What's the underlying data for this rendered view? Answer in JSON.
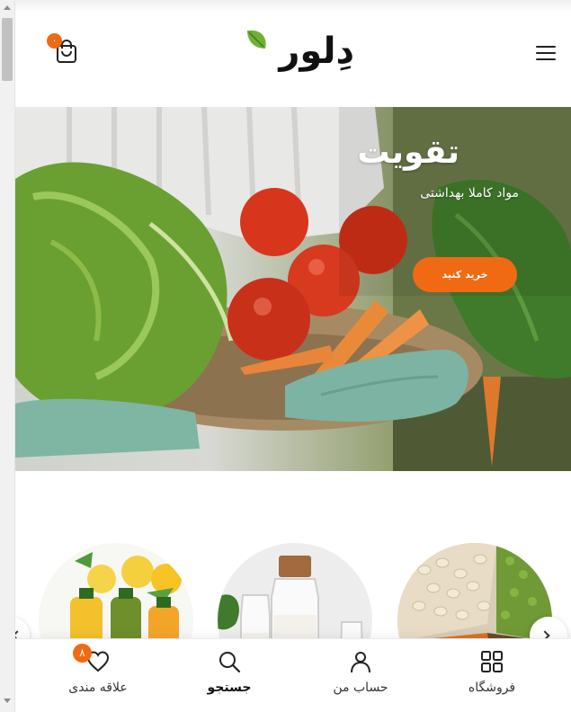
{
  "header": {
    "logo_text": "دِلور",
    "cart_count": "۰",
    "menu_icon": "hamburger-icon",
    "cart_icon": "shopping-bag-icon"
  },
  "hero": {
    "title": "تقویت",
    "subtitle": "مواد کاملا بهداشتی",
    "button_label": "خرید کنید"
  },
  "categories": {
    "items": [
      "juices",
      "milk",
      "grains-and-legumes"
    ],
    "prev_icon": "chevron-left-icon",
    "next_icon": "chevron-right-icon"
  },
  "bottom_nav": {
    "items": [
      {
        "label": "فروشگاه",
        "icon": "grid-icon"
      },
      {
        "label": "حساب من",
        "icon": "user-icon"
      },
      {
        "label": "جستجو",
        "icon": "search-icon"
      },
      {
        "label": "علاقه مندی",
        "icon": "heart-icon",
        "badge": "۸"
      }
    ]
  },
  "colors": {
    "accent": "#f06a14",
    "text": "#222222"
  }
}
